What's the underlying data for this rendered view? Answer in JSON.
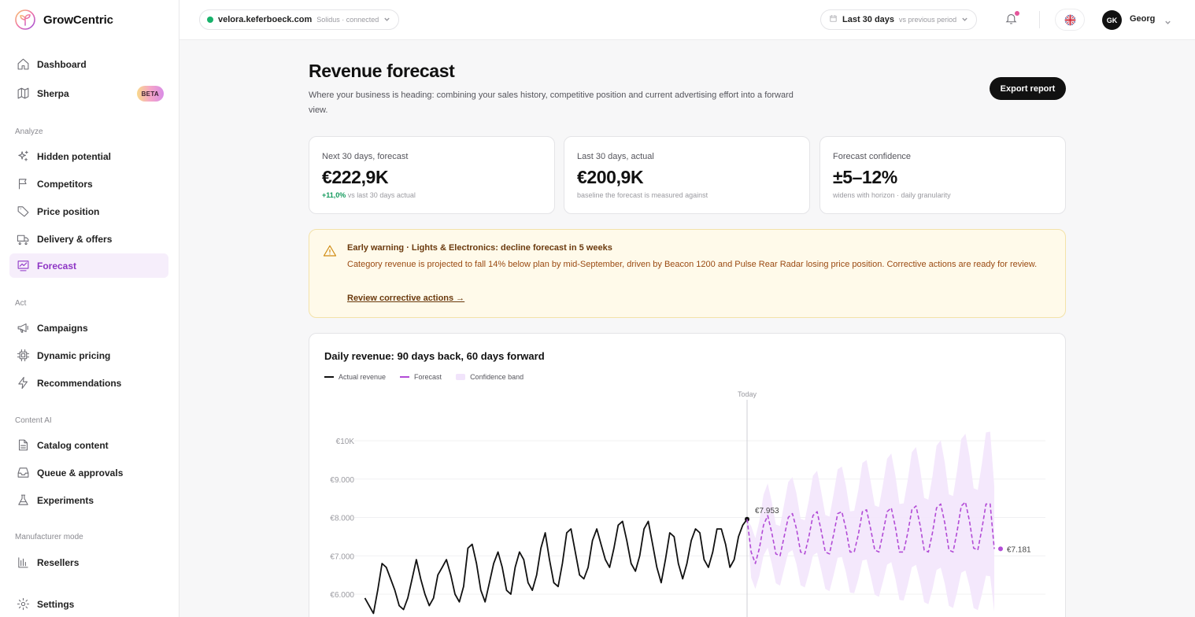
{
  "brand": {
    "name": "GrowCentric"
  },
  "sidebar": {
    "items_top": [
      {
        "label": "Dashboard",
        "icon": "home-icon"
      },
      {
        "label": "Sherpa",
        "icon": "map-icon",
        "badge": "BETA"
      }
    ],
    "sections": [
      {
        "title": "Analyze",
        "items": [
          {
            "label": "Hidden potential",
            "icon": "sparkle-icon"
          },
          {
            "label": "Competitors",
            "icon": "flag-icon"
          },
          {
            "label": "Price position",
            "icon": "tag-icon"
          },
          {
            "label": "Delivery & offers",
            "icon": "truck-icon"
          },
          {
            "label": "Forecast",
            "icon": "chart-icon",
            "active": true
          }
        ]
      },
      {
        "title": "Act",
        "items": [
          {
            "label": "Campaigns",
            "icon": "megaphone-icon"
          },
          {
            "label": "Dynamic pricing",
            "icon": "chip-icon"
          },
          {
            "label": "Recommendations",
            "icon": "bolt-icon"
          }
        ]
      },
      {
        "title": "Content AI",
        "items": [
          {
            "label": "Catalog content",
            "icon": "file-icon"
          },
          {
            "label": "Queue & approvals",
            "icon": "inbox-icon"
          },
          {
            "label": "Experiments",
            "icon": "flask-icon"
          }
        ]
      },
      {
        "title": "Manufacturer mode",
        "items": [
          {
            "label": "Resellers",
            "icon": "bars-icon"
          }
        ]
      }
    ],
    "settings": {
      "label": "Settings",
      "icon": "gear-icon"
    }
  },
  "topbar": {
    "site": "velora.keferboeck.com",
    "site_status": "Solidus · connected",
    "period": "Last 30 days",
    "period_compare": "vs previous period",
    "user_initials": "GK",
    "user_name": "Georg"
  },
  "page": {
    "title": "Revenue forecast",
    "subtitle": "Where your business is heading: combining your sales history, competitive position and current advertising effort into a forward view.",
    "export_label": "Export report"
  },
  "kpis": [
    {
      "label": "Next 30 days, forecast",
      "value": "€222,9K",
      "delta": "+11,0%",
      "note": "vs last 30 days actual"
    },
    {
      "label": "Last 30 days, actual",
      "value": "€200,9K",
      "delta": "",
      "note": "baseline the forecast is measured against"
    },
    {
      "label": "Forecast confidence",
      "value": "±5–12%",
      "delta": "",
      "note": "widens with horizon · daily granularity"
    }
  ],
  "alert": {
    "title": "Early warning · Lights & Electronics: decline forecast in 5 weeks",
    "body": "Category revenue is projected to fall 14% below plan by mid-September, driven by Beacon 1200 and Pulse Rear Radar losing price position. Corrective actions are ready for review.",
    "link": "Review corrective actions →"
  },
  "chart_data": {
    "type": "line",
    "title": "Daily revenue: 90 days back, 60 days forward",
    "legend": [
      "Actual revenue",
      "Forecast",
      "Confidence band"
    ],
    "today_label": "Today",
    "y_ticks": [
      "€6.000",
      "€7.000",
      "€8.000",
      "€9.000",
      "€10K"
    ],
    "y_tick_values": [
      6000,
      7000,
      8000,
      9000,
      10000
    ],
    "ylim": [
      5000,
      10500
    ],
    "x_range": [
      -90,
      60
    ],
    "actual_end_label": "€7.953",
    "forecast_end_label": "€7.181",
    "actual": [
      5900,
      5700,
      5500,
      6100,
      6800,
      6700,
      6400,
      6100,
      5700,
      5600,
      5900,
      6400,
      6900,
      6400,
      6000,
      5700,
      5900,
      6500,
      6700,
      6900,
      6500,
      6000,
      5800,
      6200,
      7200,
      7300,
      6800,
      6100,
      5800,
      6300,
      6800,
      7100,
      6700,
      6100,
      6000,
      6700,
      7100,
      6900,
      6300,
      6100,
      6500,
      7200,
      7600,
      6900,
      6300,
      6200,
      6800,
      7600,
      7700,
      7100,
      6500,
      6400,
      6700,
      7400,
      7700,
      7300,
      6900,
      6700,
      7200,
      7800,
      7900,
      7400,
      6800,
      6600,
      7000,
      7700,
      7900,
      7300,
      6700,
      6300,
      6900,
      7600,
      7500,
      6800,
      6400,
      6800,
      7400,
      7700,
      7600,
      6900,
      6700,
      7100,
      7700,
      7700,
      7300,
      6700,
      6900,
      7500,
      7800,
      7953
    ],
    "forecast": [
      7100,
      6800,
      7200,
      7800,
      8050,
      7600,
      7050,
      7000,
      7500,
      8000,
      8100,
      7700,
      7100,
      7050,
      7500,
      8050,
      8150,
      7650,
      7100,
      7050,
      7550,
      8100,
      8150,
      7700,
      7100,
      7100,
      7550,
      8150,
      8200,
      7700,
      7150,
      7100,
      7600,
      8150,
      8250,
      7750,
      7100,
      7100,
      7600,
      8200,
      8300,
      7800,
      7150,
      7100,
      7600,
      8250,
      8350,
      7850,
      7150,
      7100,
      7650,
      8300,
      8400,
      7900,
      7200,
      7150,
      7700,
      8350,
      8350,
      7181
    ],
    "band_half_width_pct": [
      5,
      12
    ]
  }
}
